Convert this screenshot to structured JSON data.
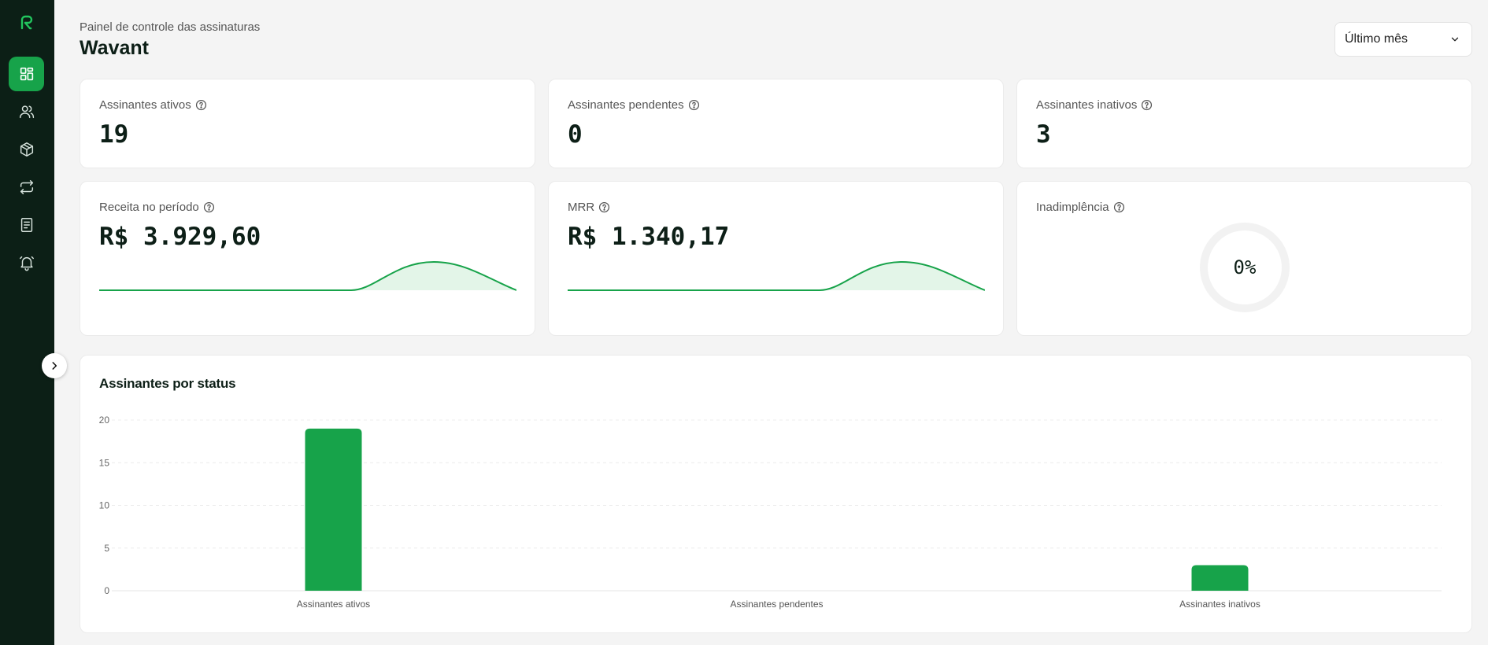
{
  "header": {
    "subtitle": "Painel de controle das assinaturas",
    "title": "Wavant"
  },
  "period_select": {
    "value": "Último mês"
  },
  "sidebar": {
    "items": [
      {
        "icon": "dashboard-icon",
        "active": true
      },
      {
        "icon": "users-icon",
        "active": false
      },
      {
        "icon": "box-icon",
        "active": false
      },
      {
        "icon": "repeat-icon",
        "active": false
      },
      {
        "icon": "document-icon",
        "active": false
      },
      {
        "icon": "alarm-icon",
        "active": false
      }
    ]
  },
  "stats": {
    "active": {
      "label": "Assinantes ativos",
      "value": "19"
    },
    "pending": {
      "label": "Assinantes pendentes",
      "value": "0"
    },
    "inactive": {
      "label": "Assinantes inativos",
      "value": "3"
    },
    "revenue": {
      "label": "Receita no período",
      "value": "R$ 3.929,60"
    },
    "mrr": {
      "label": "MRR",
      "value": "R$ 1.340,17"
    },
    "default_rate": {
      "label": "Inadimplência",
      "value": "0%"
    }
  },
  "colors": {
    "accent": "#17a34a",
    "sidebar_bg": "#0c1f16",
    "sparkline_fill": "#e3f5e8"
  },
  "chart_data": {
    "type": "bar",
    "title": "Assinantes por status",
    "categories": [
      "Assinantes ativos",
      "Assinantes pendentes",
      "Assinantes inativos"
    ],
    "values": [
      19,
      0,
      3
    ],
    "yticks": [
      "0",
      "5",
      "10",
      "15",
      "20"
    ],
    "ylim": [
      0,
      20
    ],
    "grid": true,
    "xlabel": "",
    "ylabel": ""
  }
}
